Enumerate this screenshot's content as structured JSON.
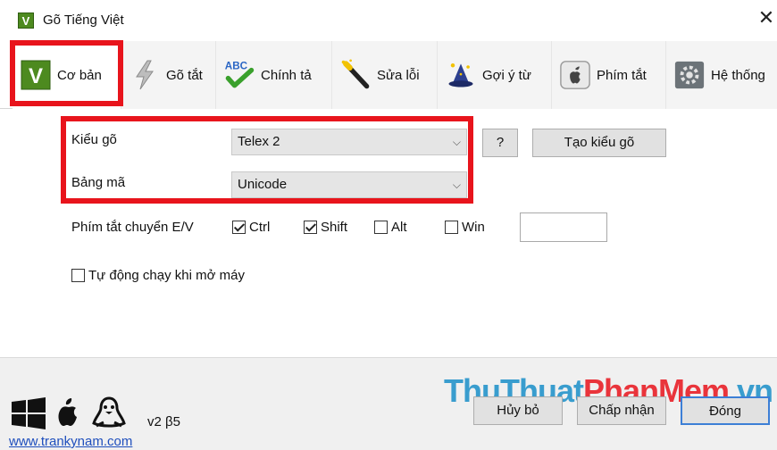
{
  "window": {
    "title": "Gõ Tiếng Việt",
    "logo_letter": "V",
    "close_glyph": "✕"
  },
  "tabs": [
    {
      "label": "Cơ bản",
      "icon": "v-logo-icon"
    },
    {
      "label": "Gõ tắt",
      "icon": "lightning-icon"
    },
    {
      "label": "Chính tả",
      "icon": "abc-check-icon"
    },
    {
      "label": "Sửa lỗi",
      "icon": "magic-wand-icon"
    },
    {
      "label": "Gợi ý từ",
      "icon": "wizard-hat-icon"
    },
    {
      "label": "Phím tắt",
      "icon": "apple-key-icon"
    },
    {
      "label": "Hệ thống",
      "icon": "system-gear-icon"
    }
  ],
  "form": {
    "input_method_label": "Kiểu gõ",
    "input_method_value": "Telex 2",
    "help_button": "?",
    "create_method_button": "Tạo kiểu gõ",
    "charset_label": "Bảng mã",
    "charset_value": "Unicode",
    "switch_label": "Phím tắt chuyển E/V",
    "switch_options": [
      {
        "label": "Ctrl",
        "checked": true
      },
      {
        "label": "Shift",
        "checked": true
      },
      {
        "label": "Alt",
        "checked": false
      },
      {
        "label": "Win",
        "checked": false
      }
    ],
    "switch_key_value": "",
    "autostart_label": "Tự động chạy khi mở máy",
    "autostart_checked": false
  },
  "footer": {
    "version": "v2 β5",
    "link": "www.trankynam.com",
    "cancel_button": "Hủy bỏ",
    "accept_button": "Chấp nhận",
    "close_button": "Đóng",
    "watermark_part1": "ThuThuat",
    "watermark_part2": "PhanMem",
    "watermark_part3": ".vn"
  },
  "colors": {
    "highlight_red": "#e8141c",
    "logo_green": "#4d8a1f",
    "link_blue": "#1f4fbd"
  }
}
